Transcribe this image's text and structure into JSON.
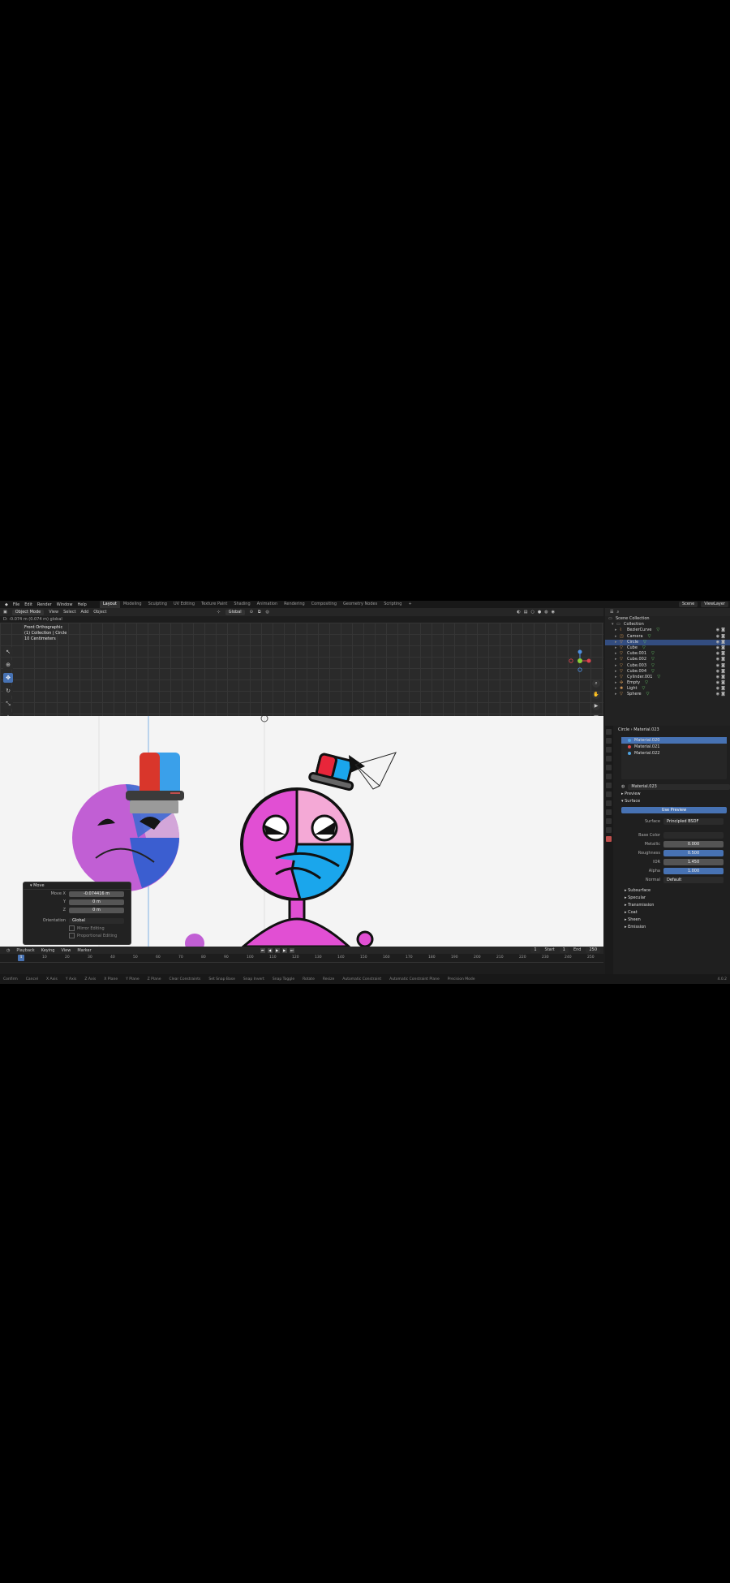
{
  "topbar": {
    "menus": [
      "File",
      "Edit",
      "Render",
      "Window",
      "Help"
    ],
    "workspaces": [
      "Layout",
      "Modeling",
      "Sculpting",
      "UV Editing",
      "Texture Paint",
      "Shading",
      "Animation",
      "Rendering",
      "Compositing",
      "Geometry Nodes",
      "Scripting",
      "+"
    ],
    "active_workspace": "Layout",
    "scene": "Scene",
    "view_layer": "ViewLayer"
  },
  "header": {
    "mode": "Object Mode",
    "menus": [
      "View",
      "Select",
      "Add",
      "Object"
    ],
    "orientation": "Global"
  },
  "status_line": "D: -0.074 m (0.074 m) global",
  "viewport": {
    "view_name": "Front Orthographic",
    "collection": "(1) Collection | Circle",
    "scale": "10 Centimeters"
  },
  "move_panel": {
    "title": "Move",
    "move_label": "Move X",
    "y_label": "Y",
    "z_label": "Z",
    "move_x": "-0.074416 m",
    "move_y": "0 m",
    "move_z": "0 m",
    "orientation_label": "Orientation",
    "orientation_value": "Global",
    "mirror_editing": "Mirror Editing",
    "proportional_editing": "Proportional Editing"
  },
  "timeline": {
    "menus": [
      "Playback",
      "Keying",
      "View",
      "Marker"
    ],
    "current_frame": "1",
    "start_label": "Start",
    "start_value": "1",
    "end_label": "End",
    "end_value": "250",
    "ticks": [
      "1",
      "10",
      "20",
      "30",
      "40",
      "50",
      "60",
      "70",
      "80",
      "90",
      "100",
      "110",
      "120",
      "130",
      "140",
      "150",
      "160",
      "170",
      "180",
      "190",
      "200",
      "210",
      "220",
      "230",
      "240",
      "250"
    ]
  },
  "statusbar": {
    "items": [
      "Confirm",
      "Cancel",
      "X Axis",
      "Y Axis",
      "Z Axis",
      "X Plane",
      "Y Plane",
      "Z Plane",
      "Clear Constraints",
      "Set Snap Base",
      "Snap Invert",
      "Snap Toggle",
      "Rotate",
      "Resize",
      "Automatic Constraint",
      "Automatic Constraint Plane",
      "Precision Mode"
    ],
    "version": "4.0.2"
  },
  "outliner": {
    "root": "Scene Collection",
    "collection": "Collection",
    "items": [
      {
        "name": "BezierCurve",
        "type": "curve"
      },
      {
        "name": "Camera",
        "type": "camera"
      },
      {
        "name": "Circle",
        "type": "mesh",
        "selected": true
      },
      {
        "name": "Cube",
        "type": "mesh"
      },
      {
        "name": "Cube.001",
        "type": "mesh"
      },
      {
        "name": "Cube.002",
        "type": "mesh"
      },
      {
        "name": "Cube.003",
        "type": "mesh"
      },
      {
        "name": "Cube.004",
        "type": "mesh"
      },
      {
        "name": "Cylinder.001",
        "type": "mesh"
      },
      {
        "name": "Empty",
        "type": "empty"
      },
      {
        "name": "Light",
        "type": "light"
      },
      {
        "name": "Sphere",
        "type": "mesh"
      }
    ]
  },
  "properties": {
    "object": "Circle",
    "material": "Material.023",
    "slots": [
      {
        "name": "Material.020",
        "color": "#4fa3e0",
        "selected": true
      },
      {
        "name": "Material.021",
        "color": "#e04a4a"
      },
      {
        "name": "Material.022",
        "color": "#4fa3e0"
      }
    ],
    "preview_label": "Preview",
    "surface_section": "Surface",
    "use_preview_label": "Use Preview",
    "surface_label": "Surface",
    "surface_value": "Principled BSDF",
    "base_color_label": "Base Color",
    "metallic_label": "Metallic",
    "metallic": "0.000",
    "roughness_label": "Roughness",
    "roughness": "0.500",
    "ior_label": "IOR",
    "ior": "1.450",
    "alpha_label": "Alpha",
    "alpha": "1.000",
    "normal_label": "Normal",
    "normal": "Default",
    "subsections": [
      "Subsurface",
      "Specular",
      "Transmission",
      "Coat",
      "Sheen",
      "Emission"
    ]
  },
  "colors": {
    "accent": "#4772b3",
    "pink": "#e14fd3",
    "light_pink": "#f4a9d6",
    "blue": "#1aa6ec",
    "red_hat": "#e8263a"
  }
}
